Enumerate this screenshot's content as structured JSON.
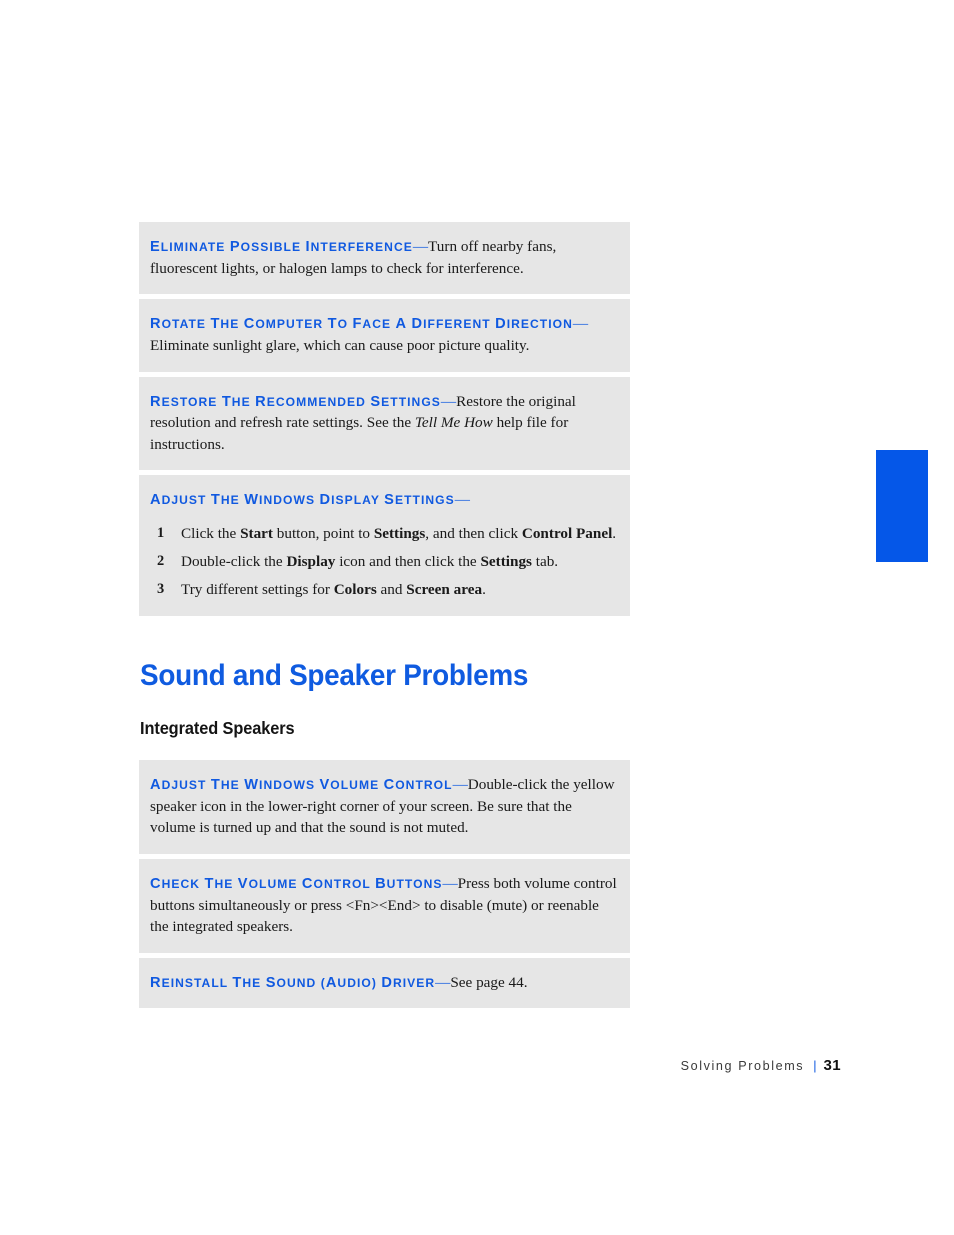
{
  "page": {
    "background_color": "#ffffff",
    "panel_color": "#E6E6E6",
    "accent_color": "#1059E0",
    "tab_color": "#0557E8"
  },
  "display_tips": [
    {
      "heading_words": [
        "Eliminate",
        "possible",
        "interference"
      ],
      "dash": "—",
      "body_prefix": "Turn off nearby fans, fluorescent lights, or halogen lamps to check for interference."
    },
    {
      "heading_words": [
        "Rotate",
        "the",
        "computer",
        "to",
        "face",
        "a",
        "different",
        "direction"
      ],
      "dash": "—",
      "body_prefix": "Eliminate sunlight glare, which can cause poor picture quality."
    },
    {
      "heading_words": [
        "Restore",
        "the",
        "recommended",
        "settings"
      ],
      "dash": "—",
      "body_prefix": "Restore the original resolution and refresh rate settings. See the ",
      "body_italic": "Tell Me How",
      "body_suffix": " help file for instructions."
    }
  ],
  "display_settings_panel": {
    "heading_words": [
      "Adjust",
      "the",
      "Windows",
      "display",
      "settings"
    ],
    "dash": "—",
    "steps": [
      {
        "number": "1",
        "parts": [
          {
            "text": "Click the ",
            "bold": false
          },
          {
            "text": "Start",
            "bold": true
          },
          {
            "text": " button, point to ",
            "bold": false
          },
          {
            "text": "Settings",
            "bold": true
          },
          {
            "text": ", and then click ",
            "bold": false
          },
          {
            "text": "Control Panel",
            "bold": true
          },
          {
            "text": ".",
            "bold": false
          }
        ]
      },
      {
        "number": "2",
        "parts": [
          {
            "text": "Double-click the ",
            "bold": false
          },
          {
            "text": "Display",
            "bold": true
          },
          {
            "text": " icon and then click the ",
            "bold": false
          },
          {
            "text": "Settings",
            "bold": true
          },
          {
            "text": " tab.",
            "bold": false
          }
        ]
      },
      {
        "number": "3",
        "parts": [
          {
            "text": "Try different settings for ",
            "bold": false
          },
          {
            "text": "Colors",
            "bold": true
          },
          {
            "text": " and ",
            "bold": false
          },
          {
            "text": "Screen area",
            "bold": true
          },
          {
            "text": ".",
            "bold": false
          }
        ]
      }
    ]
  },
  "section": {
    "title": "Sound and Speaker Problems",
    "subtitle": "Integrated Speakers"
  },
  "sound_tips": [
    {
      "heading_words": [
        "Adjust",
        "the",
        "Windows",
        "volume",
        "control"
      ],
      "dash": "—",
      "body_prefix": "Double-click the yellow speaker icon in the lower-right corner of your screen. Be sure that the volume is turned up and that the sound is not muted."
    },
    {
      "heading_words": [
        "Check",
        "the",
        "volume",
        "control",
        "buttons"
      ],
      "dash": "—",
      "body_prefix": "Press both volume control buttons simultaneously or press ",
      "body_keys": "<Fn><End>",
      "body_suffix": " to disable (mute) or reenable the integrated speakers."
    },
    {
      "heading_words": [
        "Reinstall",
        "the",
        "Sound",
        "(audio)",
        "driver"
      ],
      "dash": "—",
      "body_prefix": "See page 44."
    }
  ],
  "footer": {
    "label": "Solving Problems",
    "separator": "|",
    "page_number": "31"
  }
}
